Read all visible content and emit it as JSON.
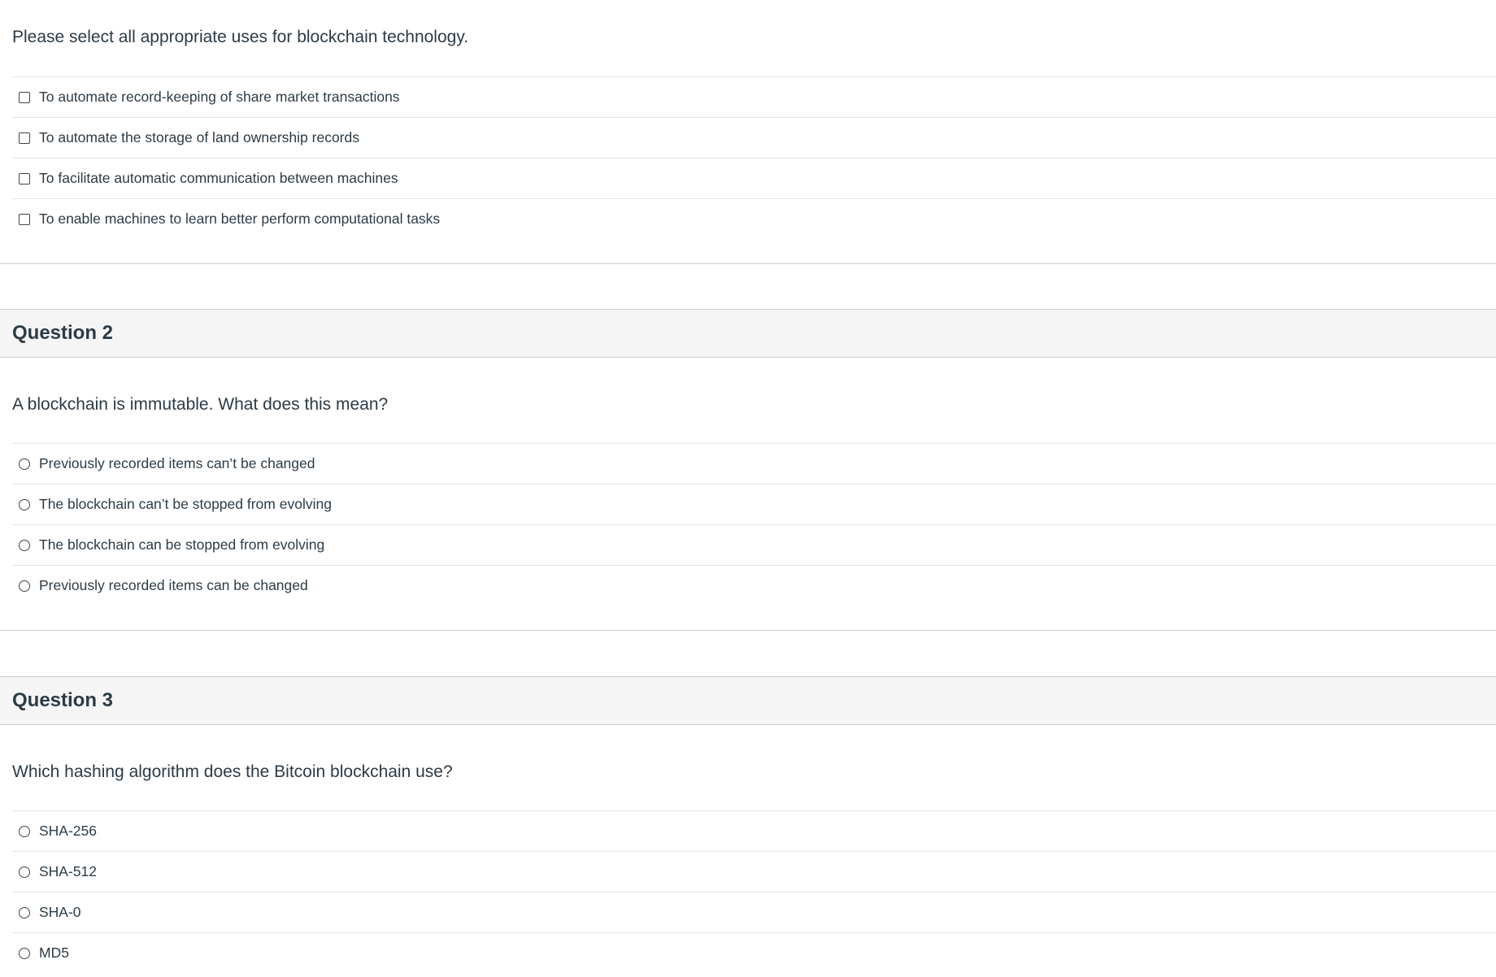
{
  "questions": [
    {
      "title": "",
      "prompt": "Please select all appropriate uses for blockchain technology.",
      "type": "checkbox",
      "answers": [
        "To automate record-keeping of share market transactions",
        "To automate the storage of land ownership records",
        "To facilitate automatic communication between machines",
        "To enable machines to learn better perform computational tasks"
      ]
    },
    {
      "title": "Question 2",
      "prompt": "A blockchain is immutable. What does this mean?",
      "type": "radio",
      "answers": [
        "Previously recorded items can’t be changed",
        "The blockchain can’t be stopped from evolving",
        "The blockchain can be stopped from evolving",
        "Previously recorded items can be changed"
      ]
    },
    {
      "title": "Question 3",
      "prompt": "Which hashing algorithm does the Bitcoin blockchain use?",
      "type": "radio",
      "answers": [
        "SHA-256",
        "SHA-512",
        "SHA-0",
        "MD5"
      ]
    }
  ]
}
